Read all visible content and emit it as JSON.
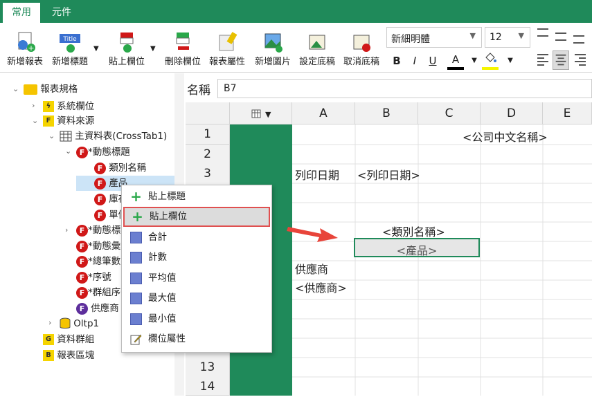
{
  "tabs": [
    {
      "label": "常用"
    },
    {
      "label": "元件"
    }
  ],
  "ribbon": {
    "buttons": [
      {
        "label": "新增報表"
      },
      {
        "label": "新增標題"
      },
      {
        "label": "貼上欄位"
      },
      {
        "label": "刪除欄位"
      },
      {
        "label": "報表屬性"
      },
      {
        "label": "新增圖片"
      },
      {
        "label": "設定底稿"
      },
      {
        "label": "取消底稿"
      }
    ],
    "title_icon_text": "Title",
    "font": "新細明體",
    "font_size": "12",
    "bold": "B",
    "italic": "I",
    "underline": "U",
    "font_color_glyph": "A",
    "colors": {
      "accent": "#1f8a5a",
      "highlight": "#f5f500"
    }
  },
  "tree": {
    "root": "報表規格",
    "items": [
      {
        "label": "系統欄位"
      },
      {
        "label": "資料來源"
      },
      {
        "label": "主資料表(CrossTab1)"
      },
      {
        "label": "*動態標題"
      },
      {
        "label": "類別名稱"
      },
      {
        "label": "產品"
      },
      {
        "label": "庫存"
      },
      {
        "label": "單價"
      },
      {
        "label": "*動態標題"
      },
      {
        "label": "*動態彙總"
      },
      {
        "label": "*總筆數"
      },
      {
        "label": "*序號"
      },
      {
        "label": "*群組序號"
      },
      {
        "label": "供應商"
      },
      {
        "label": "Oltp1"
      },
      {
        "label": "資料群組"
      },
      {
        "label": "報表區塊"
      }
    ]
  },
  "namebar": {
    "label": "名稱",
    "value": "B7"
  },
  "grid": {
    "columns": [
      "A",
      "B",
      "C",
      "D",
      "E"
    ],
    "rows": [
      "1",
      "2",
      "3",
      "4",
      "5",
      "6",
      "7",
      "8",
      "9",
      "10",
      "11",
      "12",
      "13",
      "14"
    ],
    "cells": {
      "company": "<公司中文名稱>",
      "print_date_label": "列印日期",
      "print_date": "<列印日期>",
      "category": "<類別名稱>",
      "product": "<產品>",
      "supplier_label": "供應商",
      "supplier": "<供應商>"
    }
  },
  "context_menu": {
    "items": [
      {
        "label": "貼上標題"
      },
      {
        "label": "貼上欄位"
      },
      {
        "label": "合計"
      },
      {
        "label": "計數"
      },
      {
        "label": "平均值"
      },
      {
        "label": "最大值"
      },
      {
        "label": "最小值"
      },
      {
        "label": "欄位屬性"
      }
    ]
  }
}
